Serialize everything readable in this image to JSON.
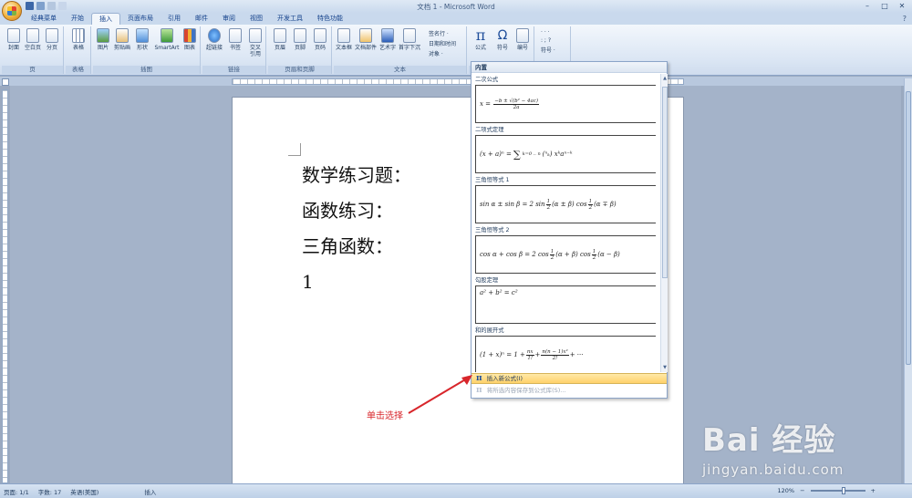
{
  "window": {
    "title": "文档 1 - Microsoft Word"
  },
  "tabs": [
    "经典菜单",
    "开始",
    "插入",
    "页面布局",
    "引用",
    "邮件",
    "审阅",
    "视图",
    "开发工具",
    "特色功能"
  ],
  "active_tab": "插入",
  "ribbon": {
    "groups": [
      {
        "label": "页",
        "buttons": [
          "封面",
          "空白页",
          "分页"
        ]
      },
      {
        "label": "表格",
        "buttons": [
          "表格"
        ]
      },
      {
        "label": "插图",
        "buttons": [
          "图片",
          "剪贴画",
          "形状",
          "SmartArt",
          "图表"
        ]
      },
      {
        "label": "链接",
        "buttons": [
          "超链接",
          "书签",
          "交叉引用"
        ]
      },
      {
        "label": "页眉和页脚",
        "buttons": [
          "页眉",
          "页脚",
          "页码"
        ]
      },
      {
        "label": "文本",
        "buttons": [
          "文本框",
          "文档部件",
          "艺术字",
          "首字下沉"
        ],
        "small": [
          "签名行 ·",
          "日期和时间",
          "对象 ·"
        ]
      },
      {
        "label": "",
        "buttons": [
          "公式",
          "符号",
          "编号"
        ]
      },
      {
        "label": "",
        "small": [
          "符号 ·"
        ]
      }
    ]
  },
  "document": {
    "lines": [
      "数学练习题：",
      "函数练习：",
      "三角函数：",
      "1"
    ]
  },
  "gallery": {
    "header": "内置",
    "items": [
      {
        "caption": "二次公式"
      },
      {
        "caption": "二项式定理"
      },
      {
        "caption": "三角恒等式 1"
      },
      {
        "caption": "三角恒等式 2"
      },
      {
        "caption": "勾股定理"
      },
      {
        "caption": "和的展开式"
      }
    ],
    "insert_label": "插入新公式(I)",
    "save_label": "将所选内容保存到公式库(S)..."
  },
  "annotation": {
    "text": "单击选择"
  },
  "statusbar": {
    "page": "页面: 1/1",
    "words": "字数: 17",
    "language": "英语(美国)",
    "mode": "插入",
    "zoom": "120%"
  },
  "watermark": {
    "brand": "Bai 经验",
    "url": "jingyan.baidu.com"
  }
}
